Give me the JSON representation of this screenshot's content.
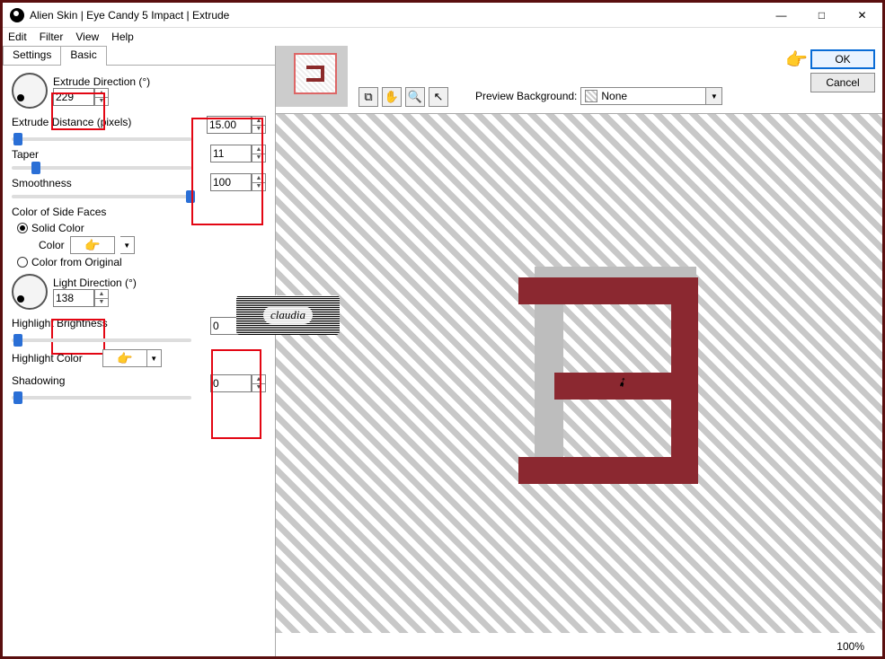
{
  "window": {
    "title": "Alien Skin | Eye Candy 5 Impact | Extrude"
  },
  "menu": {
    "edit": "Edit",
    "filter": "Filter",
    "view": "View",
    "help": "Help"
  },
  "tabs": {
    "settings": "Settings",
    "basic": "Basic"
  },
  "params": {
    "extrude_direction_label": "Extrude Direction (°)",
    "extrude_direction_value": "229",
    "extrude_distance_label": "Extrude Distance (pixels)",
    "extrude_distance_value": "15.00",
    "taper_label": "Taper",
    "taper_value": "11",
    "smoothness_label": "Smoothness",
    "smoothness_value": "100",
    "color_side_label": "Color of Side Faces",
    "solid_color_label": "Solid Color",
    "color_label": "Color",
    "color_from_original_label": "Color from Original",
    "light_direction_label": "Light Direction (°)",
    "light_direction_value": "138",
    "highlight_brightness_label": "Highlight Brightness",
    "highlight_brightness_value": "0",
    "highlight_color_label": "Highlight Color",
    "shadowing_label": "Shadowing",
    "shadowing_value": "0"
  },
  "preview": {
    "bg_label": "Preview Background:",
    "bg_value": "None"
  },
  "buttons": {
    "ok": "OK",
    "cancel": "Cancel"
  },
  "zoom": "100%",
  "watermark": "claudia"
}
